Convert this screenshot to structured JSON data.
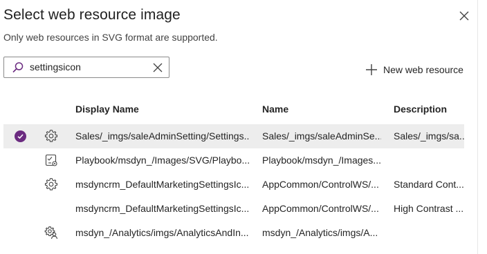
{
  "dialog": {
    "title": "Select web resource image",
    "subtitle": "Only web resources in SVG format are supported."
  },
  "search": {
    "value": "settingsicon"
  },
  "toolbar": {
    "new_label": "New web resource"
  },
  "columns": {
    "display_name": "Display Name",
    "name": "Name",
    "description": "Description"
  },
  "rows": [
    {
      "display": "Sales/_imgs/saleAdminSetting/Settings...",
      "name": "Sales/_imgs/saleAdminSe...",
      "description": "Sales/_imgs/sa...",
      "icon": "gear-icon",
      "selected": true
    },
    {
      "display": "Playbook/msdyn_/Images/SVG/Playbo...",
      "name": "Playbook/msdyn_/Images...",
      "description": "",
      "icon": "checklist-icon",
      "selected": false
    },
    {
      "display": "msdyncrm_DefaultMarketingSettingsIc...",
      "name": "AppCommon/ControlWS/...",
      "description": "Standard Cont...",
      "icon": "gear-icon",
      "selected": false
    },
    {
      "display": "msdyncrm_DefaultMarketingSettingsIc...",
      "name": "AppCommon/ControlWS/...",
      "description": "High Contrast ...",
      "icon": "",
      "selected": false
    },
    {
      "display": "msdyn_/Analytics/imgs/AnalyticsAndIn...",
      "name": "msdyn_/Analytics/imgs/A...",
      "description": "",
      "icon": "people-settings-icon",
      "selected": false
    }
  ],
  "colors": {
    "accent": "#6b2b80",
    "selected_row": "#ededed"
  }
}
